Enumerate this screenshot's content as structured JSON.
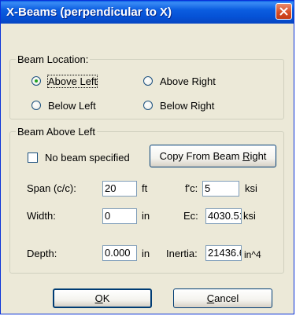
{
  "window": {
    "title": "X-Beams (perpendicular to X)"
  },
  "beam_location": {
    "legend": "Beam Location:",
    "options": [
      {
        "label": "Above Left",
        "checked": true
      },
      {
        "label": "Above Right",
        "checked": false
      },
      {
        "label": "Below Left",
        "checked": false
      },
      {
        "label": "Below Right",
        "checked": false
      }
    ]
  },
  "beam_group": {
    "legend": "Beam Above Left",
    "no_beam_label": "No beam specified",
    "no_beam_checked": false,
    "copy_button": {
      "prefix": "Copy From Beam ",
      "mnemonic": "R",
      "suffix": "ight"
    },
    "fields": {
      "span": {
        "label": "Span (c/c):",
        "value": "20",
        "unit": "ft"
      },
      "width": {
        "label": "Width:",
        "value": "0",
        "unit": "in"
      },
      "depth": {
        "label": "Depth:",
        "value": "0.000",
        "unit": "in"
      },
      "fc": {
        "label": "f'c:",
        "value": "5",
        "unit": "ksi"
      },
      "ec": {
        "label": "Ec:",
        "value": "4030.51",
        "unit": "ksi"
      },
      "inertia": {
        "label": "Inertia:",
        "value": "21436.6",
        "unit": "in^4"
      }
    }
  },
  "buttons": {
    "ok": {
      "mnemonic": "O",
      "suffix": "K"
    },
    "cancel": {
      "mnemonic": "C",
      "suffix": "ancel"
    }
  },
  "colors": {
    "titlebar": "#0b5de0",
    "close": "#d54a22",
    "dialog_bg": "#ece9d8",
    "radio_dot": "#21a121"
  },
  "icons": {
    "close": "close-x-icon"
  }
}
